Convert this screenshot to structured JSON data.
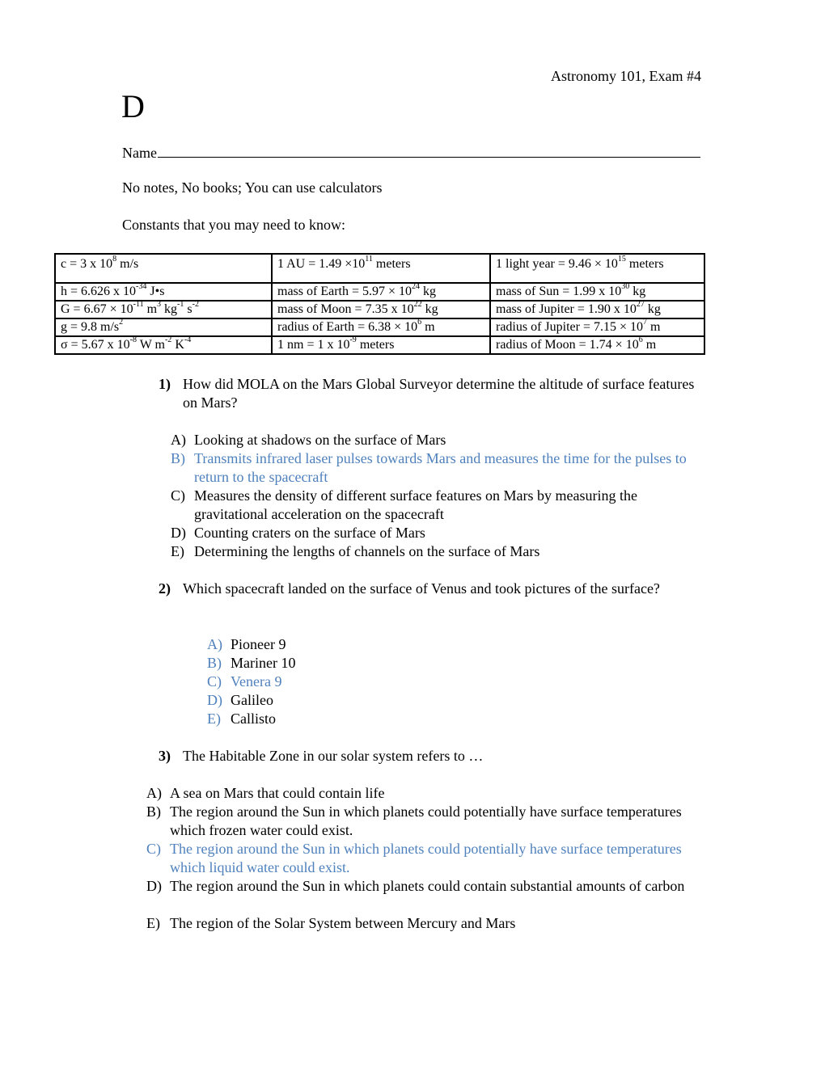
{
  "header": {
    "course": "Astronomy 101, Exam #4",
    "version": "D",
    "name_label": "Name",
    "instructions": "No notes, No books; You can use calculators",
    "constants_intro": "Constants that you may need to know:"
  },
  "constants": [
    [
      {
        "pre": "c = 3 x 10",
        "sup": "8",
        "post": " m/s"
      },
      {
        "pre": "1 AU =  1.49 ×10",
        "sup": "11",
        "post": " meters"
      },
      {
        "pre": "1 light year = 9.46 × 10",
        "sup": "15",
        "post": " meters"
      }
    ],
    [
      {
        "pre": "h = 6.626 x 10",
        "sup": "-34",
        "post": " J•s"
      },
      {
        "pre": "mass of Earth = 5.97 × 10",
        "sup": "24",
        "post": " kg"
      },
      {
        "pre": "mass of Sun = 1.99 x 10",
        "sup": "30",
        "post": " kg"
      }
    ],
    [
      {
        "pre": "G =  6.67 × 10",
        "sup": "-11",
        "post": " m",
        "sup2": "3",
        "post2": " kg",
        "sup3": "-1",
        "post3": " s",
        "sup4": "-2"
      },
      {
        "pre": "mass of Moon = 7.35 x 10",
        "sup": "22",
        "post": " kg"
      },
      {
        "pre": "mass of Jupiter = 1.90 x 10",
        "sup": "27",
        "post": " kg"
      }
    ],
    [
      {
        "pre": "g = 9.8 m/s",
        "sup": "2",
        "post": ""
      },
      {
        "pre": "radius of Earth = 6.38 × 10",
        "sup": "6",
        "post": " m"
      },
      {
        "pre": "radius of Jupiter =  7.15 × 10",
        "sup": "7",
        "post": " m"
      }
    ],
    [
      {
        "pre": "σ = 5.67 x 10",
        "sup": "-8",
        "post": " W m",
        "sup2": "-2",
        "post2": " K",
        "sup3": "-4"
      },
      {
        "pre": "1 nm = 1 x 10",
        "sup": "-9",
        "post": " meters"
      },
      {
        "pre": "radius of Moon = 1.74 × 10",
        "sup": "6",
        "post": " m"
      }
    ]
  ],
  "colors": {
    "answer_highlight": "#4f81bd",
    "text": "#000000"
  },
  "questions": [
    {
      "number": "1)",
      "text": "How did MOLA on the Mars Global Surveyor determine the altitude of surface features on Mars?",
      "options": [
        {
          "label": "A)",
          "text": "Looking at shadows on the surface of Mars"
        },
        {
          "label": "B)",
          "text": "Transmits infrared laser pulses towards Mars and measures the time for the pulses to return to the spacecraft",
          "highlighted": true
        },
        {
          "label": "C)",
          "text": "Measures the density of different surface features on Mars by measuring the gravitational acceleration on the spacecraft"
        },
        {
          "label": "D)",
          "text": "Counting craters on the surface of Mars"
        },
        {
          "label": "E)",
          "text": "Determining the lengths of channels on the surface of Mars"
        }
      ]
    },
    {
      "number": "2)",
      "text": "Which spacecraft landed on the surface of Venus and took pictures of the surface?",
      "options": [
        {
          "label": "A)",
          "text": "Pioneer 9"
        },
        {
          "label": "B)",
          "text": "Mariner 10"
        },
        {
          "label": "C)",
          "text": "Venera 9",
          "highlighted": true
        },
        {
          "label": "D)",
          "text": "Galileo"
        },
        {
          "label": "E)",
          "text": "Callisto"
        }
      ]
    },
    {
      "number": "3)",
      "text": "The Habitable Zone in our solar system refers to …",
      "options": [
        {
          "label": "A)",
          "text": "A sea on Mars that could contain life"
        },
        {
          "label": "B)",
          "text": "The region around the Sun in which planets could potentially have surface temperatures which frozen water could exist."
        },
        {
          "label": "C)",
          "text": "The region around the Sun in which planets could potentially have surface temperatures which liquid water could exist.",
          "highlighted": true
        },
        {
          "label": "D)",
          "text": "The region around the Sun in which planets could contain substantial amounts of carbon"
        },
        {
          "label": "E)",
          "text": "The region of the Solar System between Mercury and Mars"
        }
      ]
    }
  ]
}
